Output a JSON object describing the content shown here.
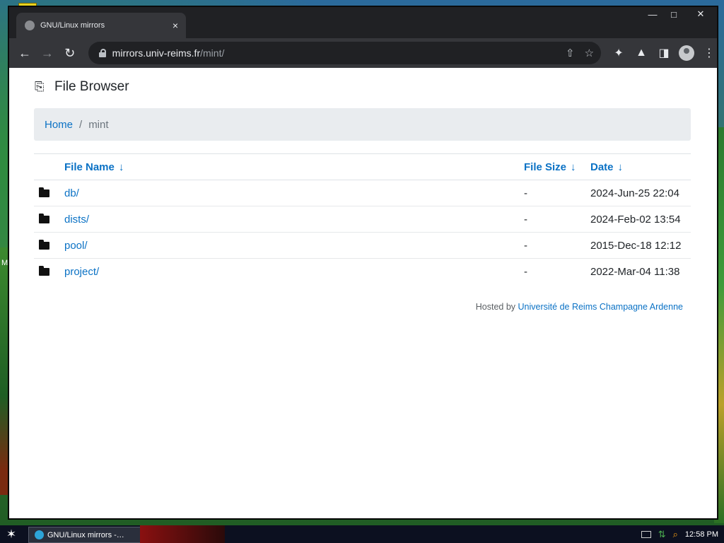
{
  "browser": {
    "tab_title": "GNU/Linux mirrors",
    "tab_close": "×",
    "url_host": "mirrors.univ-reims.fr",
    "url_path": "/mint/",
    "icons": [
      "back-arrow-icon",
      "forward-arrow-icon",
      "reload-icon",
      "lock-icon",
      "share-icon",
      "star-icon",
      "extensions-icon",
      "labs-icon",
      "side-panel-icon",
      "profile-icon",
      "menu-icon"
    ]
  },
  "page": {
    "header_title": "File Browser",
    "breadcrumb": {
      "home": "Home",
      "separator": "/",
      "current": "mint"
    },
    "table": {
      "headers": {
        "name": "File Name",
        "size": "File Size",
        "date": "Date",
        "sort_arrow": "↓"
      },
      "rows": [
        {
          "name": "db/",
          "size": "-",
          "date": "2024-Jun-25 22:04"
        },
        {
          "name": "dists/",
          "size": "-",
          "date": "2024-Feb-02 13:54"
        },
        {
          "name": "pool/",
          "size": "-",
          "date": "2015-Dec-18 12:12"
        },
        {
          "name": "project/",
          "size": "-",
          "date": "2022-Mar-04 11:38"
        }
      ]
    },
    "footer": {
      "prefix": "Hosted by",
      "link": "Université de Reims Champagne Ardenne"
    }
  },
  "taskbar": {
    "task_label": "GNU/Linux mirrors -…",
    "clock": "12:58 PM"
  },
  "desktop": {
    "left_edge_text": "M"
  },
  "colors": {
    "link": "#0b72c5",
    "breadcrumb_bg": "#e9ecef",
    "chrome_dark": "#202124",
    "toolbar": "#35363a"
  }
}
